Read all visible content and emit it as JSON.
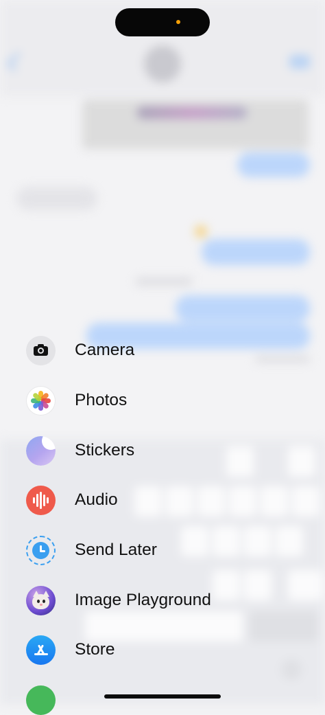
{
  "menu": {
    "items": [
      {
        "label": "Camera",
        "icon": "camera-icon"
      },
      {
        "label": "Photos",
        "icon": "photos-icon"
      },
      {
        "label": "Stickers",
        "icon": "stickers-icon"
      },
      {
        "label": "Audio",
        "icon": "audio-waveform-icon"
      },
      {
        "label": "Send Later",
        "icon": "clock-icon"
      },
      {
        "label": "Image Playground",
        "icon": "image-playground-icon"
      },
      {
        "label": "Store",
        "icon": "app-store-icon"
      }
    ]
  },
  "colors": {
    "audio": "#ef5a4b",
    "send_later": "#3a9ff0",
    "store": "#1877f0",
    "indicator": "#f5a006"
  }
}
